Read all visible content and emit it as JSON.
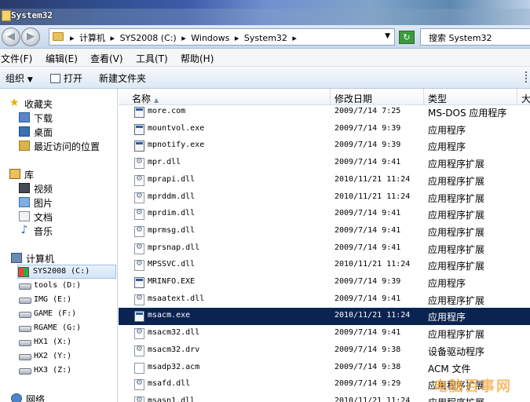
{
  "window": {
    "title": "System32"
  },
  "address": {
    "crumbs": [
      "计算机",
      "SYS2008 (C:)",
      "Windows",
      "System32"
    ],
    "search_placeholder": "搜索 System32"
  },
  "menu": [
    "文件(F)",
    "编辑(E)",
    "查看(V)",
    "工具(T)",
    "帮助(H)"
  ],
  "toolbar": {
    "organize": "组织",
    "open": "打开",
    "new_folder": "新建文件夹"
  },
  "nav": {
    "favorites": {
      "label": "收藏夹",
      "items": [
        "下载",
        "桌面",
        "最近访问的位置"
      ]
    },
    "libraries": {
      "label": "库",
      "items": [
        "视频",
        "图片",
        "文档",
        "音乐"
      ]
    },
    "computer": {
      "label": "计算机",
      "drives": [
        "SYS2008 (C:)",
        "tools (D:)",
        "IMG (E:)",
        "GAME (F:)",
        "RGAME (G:)",
        "HX1 (X:)",
        "HX2 (Y:)",
        "HX3 (Z:)"
      ]
    },
    "network": {
      "label": "网络"
    }
  },
  "columns": {
    "name": "名称",
    "date": "修改日期",
    "type": "类型",
    "size": "大"
  },
  "files": [
    {
      "name": "more.com",
      "date": "2009/7/14 7:25",
      "type": "MS-DOS 应用程序",
      "icon": "exe-icon"
    },
    {
      "name": "mountvol.exe",
      "date": "2009/7/14 9:39",
      "type": "应用程序",
      "icon": "exe-icon"
    },
    {
      "name": "mpnotify.exe",
      "date": "2009/7/14 9:39",
      "type": "应用程序",
      "icon": "exe-icon"
    },
    {
      "name": "mpr.dll",
      "date": "2009/7/14 9:41",
      "type": "应用程序扩展",
      "icon": "dll-icon"
    },
    {
      "name": "mprapi.dll",
      "date": "2010/11/21 11:24",
      "type": "应用程序扩展",
      "icon": "dll-icon"
    },
    {
      "name": "mprddm.dll",
      "date": "2010/11/21 11:24",
      "type": "应用程序扩展",
      "icon": "dll-icon"
    },
    {
      "name": "mprdim.dll",
      "date": "2009/7/14 9:41",
      "type": "应用程序扩展",
      "icon": "dll-icon"
    },
    {
      "name": "mprmsg.dll",
      "date": "2009/7/14 9:41",
      "type": "应用程序扩展",
      "icon": "dll-icon"
    },
    {
      "name": "mprsnap.dll",
      "date": "2009/7/14 9:41",
      "type": "应用程序扩展",
      "icon": "dll-icon"
    },
    {
      "name": "MPSSVC.dll",
      "date": "2010/11/21 11:24",
      "type": "应用程序扩展",
      "icon": "dll-icon"
    },
    {
      "name": "MRINFO.EXE",
      "date": "2009/7/14 9:39",
      "type": "应用程序",
      "icon": "exe-icon"
    },
    {
      "name": "msaatext.dll",
      "date": "2009/7/14 9:41",
      "type": "应用程序扩展",
      "icon": "dll-icon"
    },
    {
      "name": "msacm.exe",
      "date": "2010/11/21 11:24",
      "type": "应用程序",
      "icon": "exe-icon",
      "selected": true
    },
    {
      "name": "msacm32.dll",
      "date": "2009/7/14 9:41",
      "type": "应用程序扩展",
      "icon": "dll-icon"
    },
    {
      "name": "msacm32.drv",
      "date": "2009/7/14 9:38",
      "type": "设备驱动程序",
      "icon": "drv-icon"
    },
    {
      "name": "msadp32.acm",
      "date": "2009/7/14 9:38",
      "type": "ACM 文件",
      "icon": "file-icon"
    },
    {
      "name": "msafd.dll",
      "date": "2009/7/14 9:29",
      "type": "应用程序扩展",
      "icon": "dll-icon"
    },
    {
      "name": "msasn1.dll",
      "date": "2010/11/21 11:24",
      "type": "应用程序扩展",
      "icon": "dll-icon"
    }
  ],
  "watermark": "电脑百事网"
}
